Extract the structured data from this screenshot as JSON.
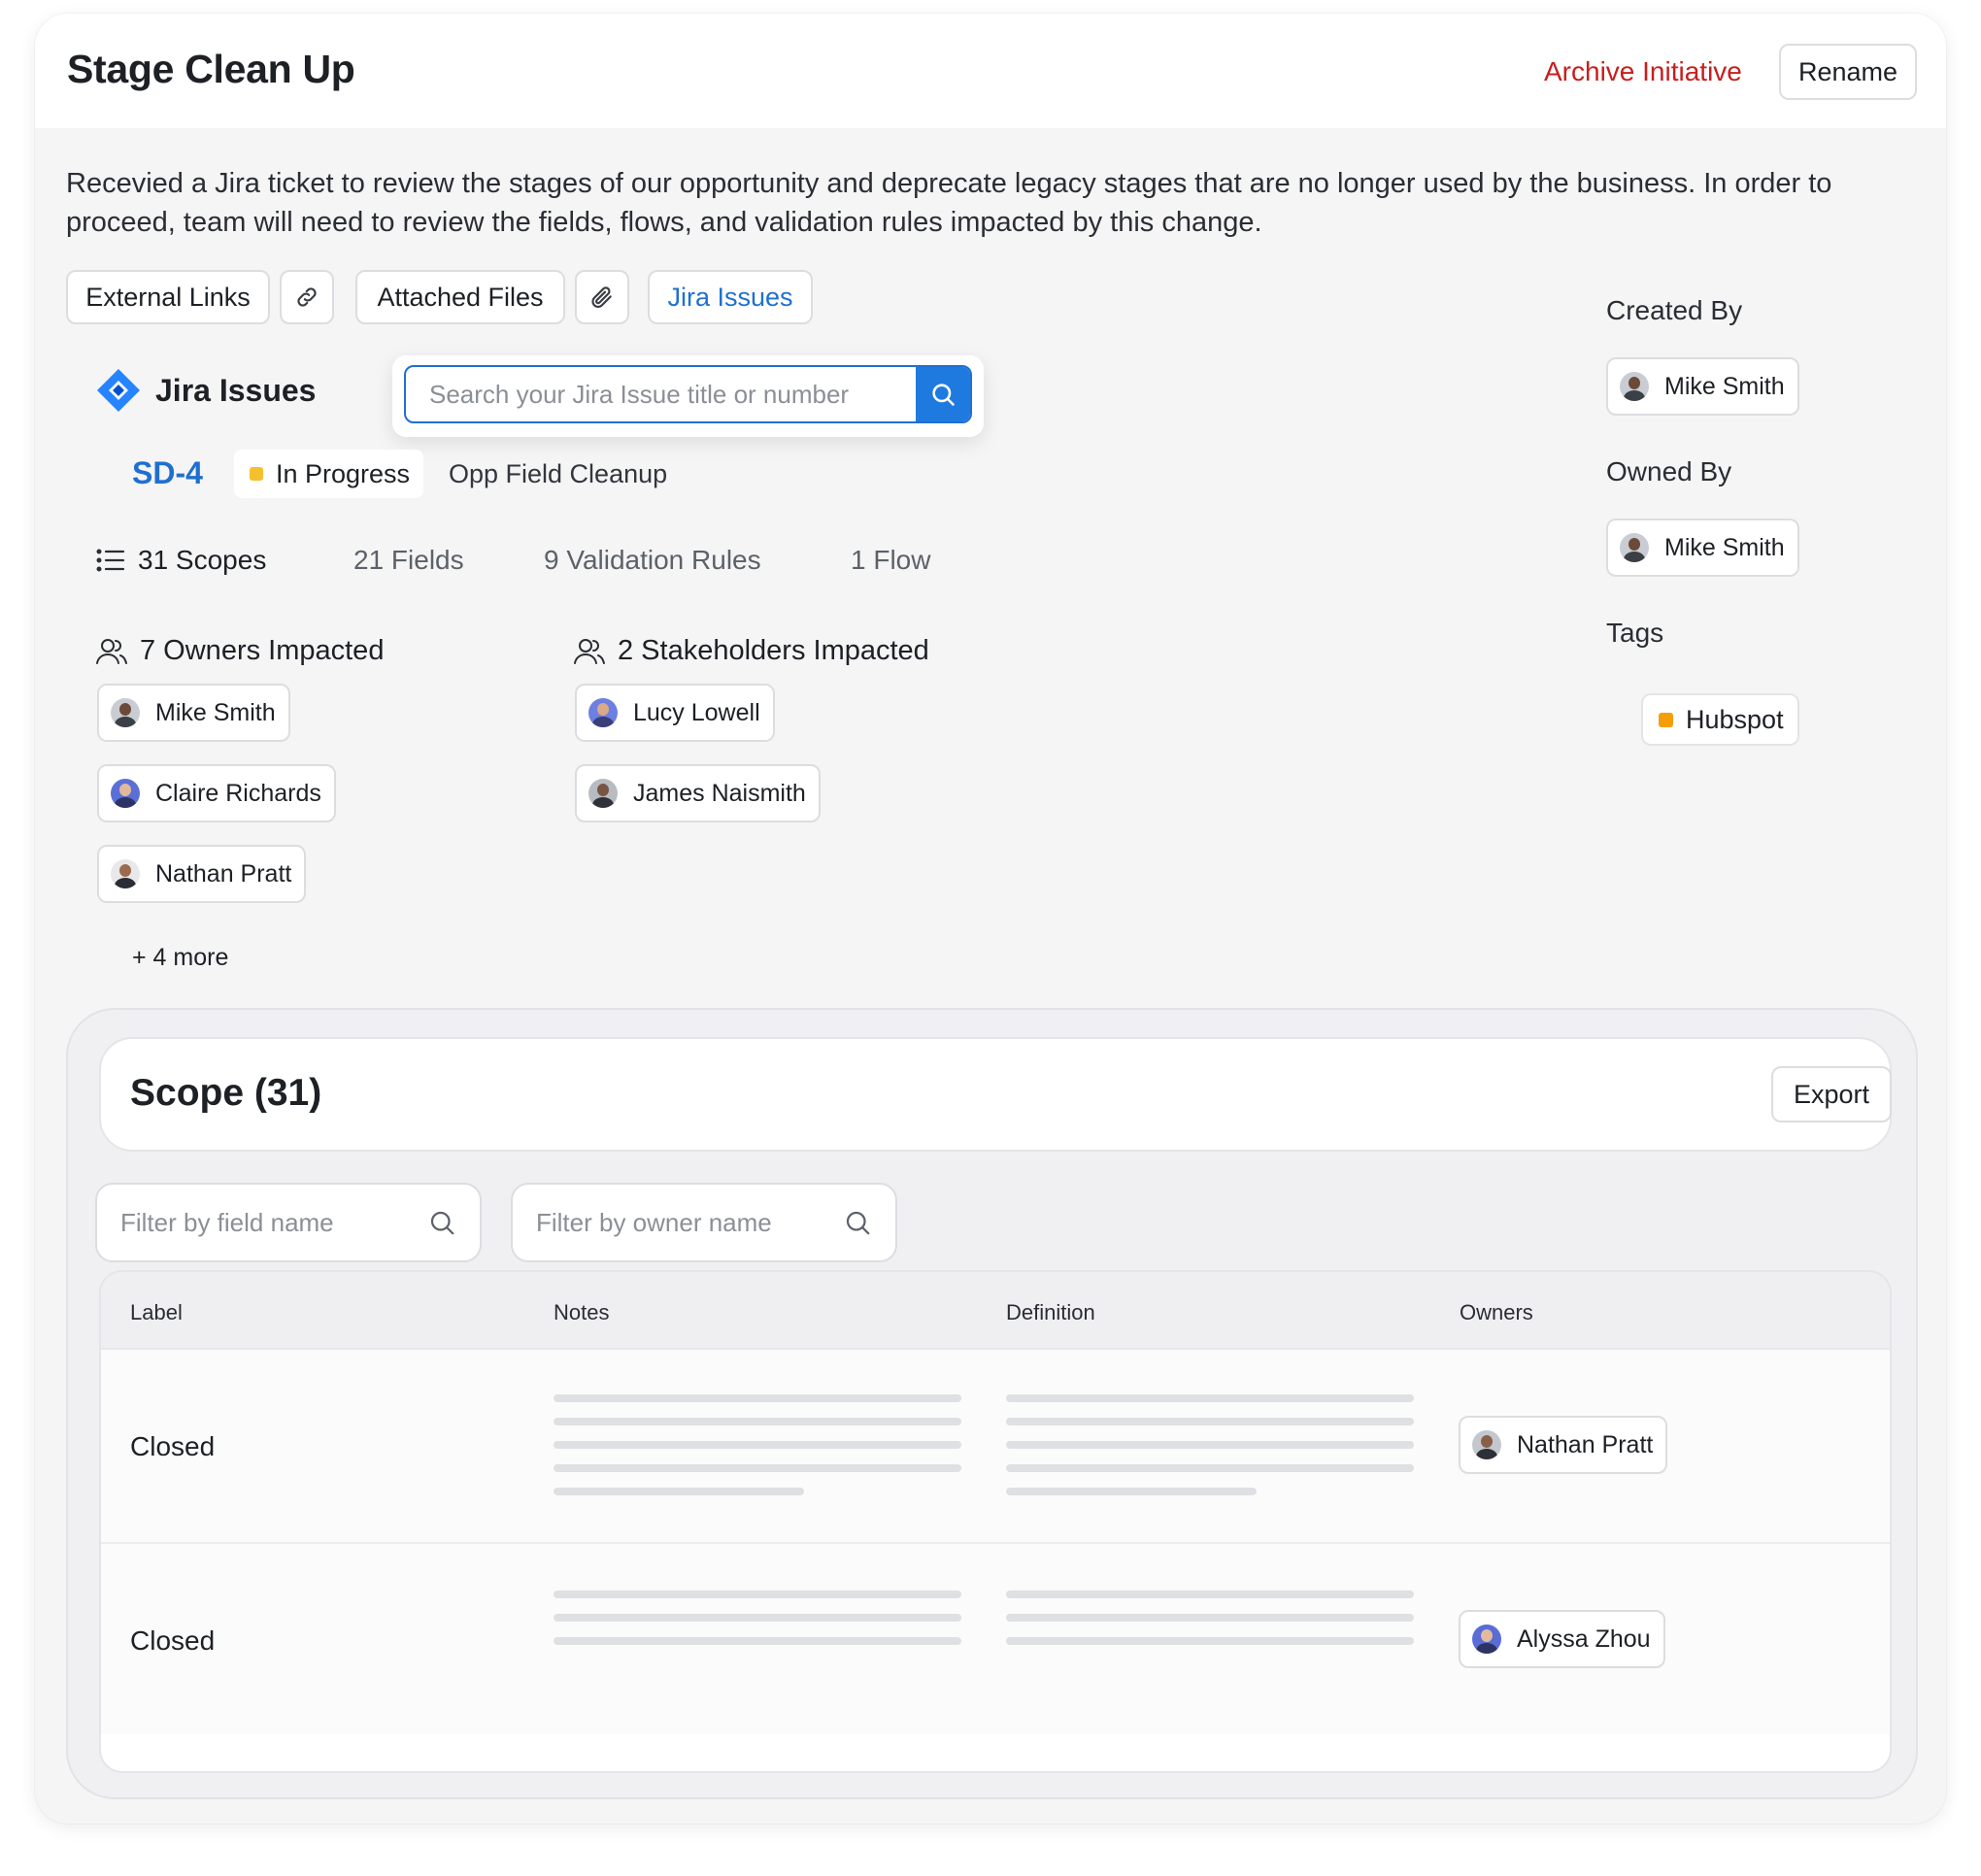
{
  "header": {
    "title": "Stage Clean Up",
    "archive_label": "Archive Initiative",
    "rename_label": "Rename"
  },
  "description": "Recevied a Jira ticket to review the stages of our opportunity and deprecate legacy stages that are no longer used by the business. In order to proceed, team will need to review the fields, flows, and validation rules impacted by this change.",
  "tabs": {
    "external_links": "External Links",
    "attached_files": "Attached Files",
    "jira_issues": "Jira Issues"
  },
  "jira": {
    "section_title": "Jira Issues",
    "search_placeholder": "Search your Jira Issue title or number",
    "issue_key": "SD-4",
    "issue_status": "In Progress",
    "issue_status_color": "#f4c02d",
    "issue_title": "Opp Field Cleanup"
  },
  "stats": {
    "scopes": "31 Scopes",
    "fields": "21 Fields",
    "validation_rules": "9 Validation Rules",
    "flows": "1 Flow"
  },
  "owners_impacted": {
    "heading": "7 Owners Impacted",
    "people": [
      "Mike Smith",
      "Claire Richards",
      "Nathan Pratt"
    ],
    "more": "+ 4 more"
  },
  "stakeholders_impacted": {
    "heading": "2 Stakeholders Impacted",
    "people": [
      "Lucy Lowell",
      "James Naismith"
    ]
  },
  "sidebar": {
    "created_by_label": "Created By",
    "created_by": "Mike Smith",
    "owned_by_label": "Owned By",
    "owned_by": "Mike Smith",
    "tags_label": "Tags",
    "tags": [
      "Hubspot"
    ],
    "tag_color": "#f59e0b"
  },
  "scope": {
    "title": "Scope (31)",
    "export_label": "Export",
    "filter_field_placeholder": "Filter by field name",
    "filter_owner_placeholder": "Filter by owner name",
    "columns": [
      "Label",
      "Notes",
      "Definition",
      "Owners"
    ],
    "rows": [
      {
        "label": "Closed",
        "owner": "Nathan Pratt"
      },
      {
        "label": "Closed",
        "owner": "Alyssa Zhou"
      }
    ]
  },
  "colors": {
    "accent_blue": "#1f6fd1",
    "danger_red": "#c81e1e"
  }
}
